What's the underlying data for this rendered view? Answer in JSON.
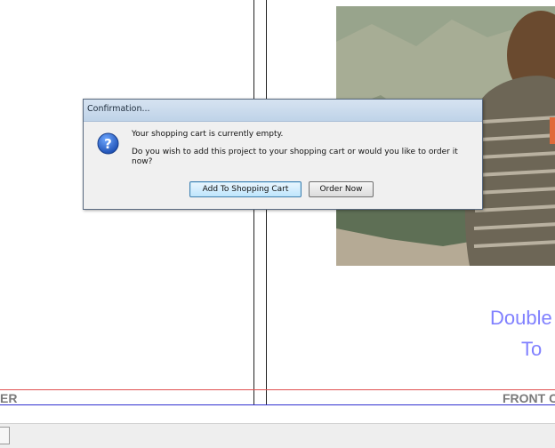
{
  "canvas": {
    "blue_text_line1": "Double",
    "blue_text_line2": "To",
    "left_label": "ER",
    "right_label": "FRONT C"
  },
  "dialog": {
    "title": "Confirmation...",
    "icon": "question-icon",
    "message_line1": "Your shopping cart is currently empty.",
    "message_line2": "Do you wish to add this project to your shopping cart or would you like to order it now?",
    "buttons": {
      "add_to_cart": "Add To Shopping Cart",
      "order_now": "Order Now"
    }
  },
  "colors": {
    "guide_red": "#e05050",
    "guide_blue": "#3030d0",
    "placeholder_text": "#8080ff"
  }
}
